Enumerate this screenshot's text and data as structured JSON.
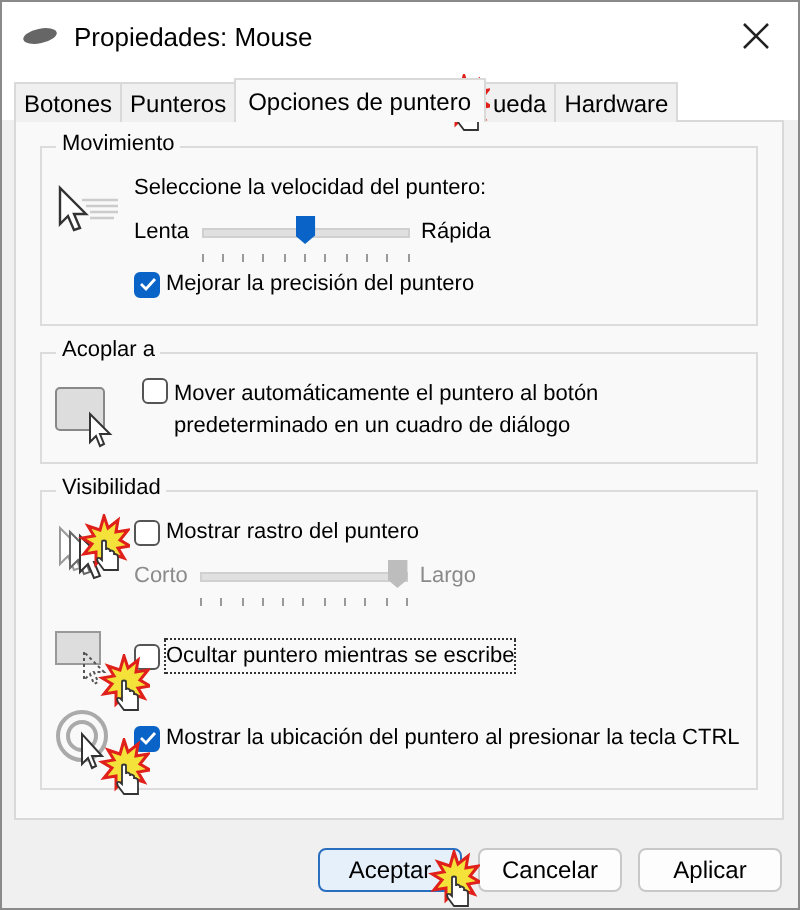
{
  "window": {
    "title": "Propiedades: Mouse"
  },
  "tabs": [
    {
      "label": "Botones",
      "selected": false
    },
    {
      "label": "Punteros",
      "selected": false
    },
    {
      "label": "Opciones de puntero",
      "selected": true
    },
    {
      "label": "ueda",
      "selected": false
    },
    {
      "label": "Hardware",
      "selected": false
    }
  ],
  "movement": {
    "title": "Movimiento",
    "prompt": "Seleccione la velocidad del puntero:",
    "slider": {
      "min_label": "Lenta",
      "max_label": "Rápida",
      "level": 0.5,
      "disabled": false
    },
    "checkbox": {
      "label": "Mejorar la precisión del puntero",
      "checked": true
    }
  },
  "snap": {
    "title": "Acoplar a",
    "checkbox": {
      "label": "Mover automáticamente el puntero al botón predeterminado en un cuadro de diálogo",
      "checked": false
    }
  },
  "visibility": {
    "title": "Visibilidad",
    "trail": {
      "label": "Mostrar rastro del puntero",
      "checked": false
    },
    "trail_slider": {
      "min_label": "Corto",
      "max_label": "Largo",
      "level": 0.95,
      "disabled": true
    },
    "hide_typing": {
      "label": "Ocultar puntero mientras se escribe",
      "checked": false
    },
    "show_ctrl": {
      "label": "Mostrar la ubicación del puntero al presionar la tecla CTRL",
      "checked": true
    }
  },
  "buttons": [
    {
      "label": "Aceptar",
      "default": true
    },
    {
      "label": "Cancelar",
      "default": false
    },
    {
      "label": "Aplicar",
      "default": false
    }
  ]
}
